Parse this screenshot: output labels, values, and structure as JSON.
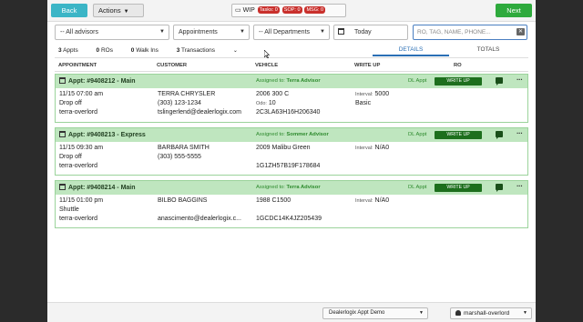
{
  "toolbar": {
    "back_label": "Back",
    "actions_label": "Actions",
    "wip_label": "WIP",
    "tasks_badge": "Tasks: 0",
    "sop_badge": "SOP: 0",
    "msg_badge": "MSG: 0",
    "next_label": "Next"
  },
  "filters": {
    "advisors": "-- All advisors",
    "type": "Appointments",
    "departments": "-- All Departments",
    "date": "Today",
    "search_placeholder": "RO, TAG, NAME, PHONE..."
  },
  "counts": [
    {
      "n": "3",
      "label": "Appts"
    },
    {
      "n": "0",
      "label": "ROs"
    },
    {
      "n": "0",
      "label": "Walk Ins"
    },
    {
      "n": "3",
      "label": "Transactions"
    }
  ],
  "tabs": {
    "details": "DETAILS",
    "totals": "TOTALS"
  },
  "columns": {
    "appointment": "APPOINTMENT",
    "customer": "CUSTOMER",
    "vehicle": "VEHICLE",
    "writeup": "WRITE UP",
    "ro": "RO"
  },
  "appointments": [
    {
      "title": "Appt: #9408212 - Main",
      "assigned_label": "Assigned to:",
      "advisor": "Terra Advisor",
      "dl": "DL Appt",
      "writeup_btn": "WRITE UP",
      "time": "11/15 07:00 am",
      "transport": "Drop off",
      "created_by": "terra-overlord",
      "customer_name": "TERRA CHRYSLER",
      "phone": "(303) 123-1234",
      "email": "tslingerlend@dealerlogix.com",
      "vehicle": "2006 300 C",
      "odo_label": "Odo:",
      "odo": "10",
      "vin": "2C3LA63H16H206340",
      "interval_label": "Interval:",
      "interval": "5000",
      "package": "Basic"
    },
    {
      "title": "Appt: #9408213 - Express",
      "assigned_label": "Assigned to:",
      "advisor": "Sommer Advisor",
      "dl": "DL Appt",
      "writeup_btn": "WRITE UP",
      "time": "11/15 09:30 am",
      "transport": "Drop off",
      "created_by": "terra-overlord",
      "customer_name": "BARBARA SMITH",
      "phone": "(303) 555-5555",
      "email": "",
      "vehicle": "2009 Malibu Green",
      "odo_label": "",
      "odo": "",
      "vin": "1G1ZH57B19F178684",
      "interval_label": "Interval:",
      "interval": "N/A0",
      "package": ""
    },
    {
      "title": "Appt: #9408214 - Main",
      "assigned_label": "Assigned to:",
      "advisor": "Terra Advisor",
      "dl": "DL Appt",
      "writeup_btn": "WRITE UP",
      "time": "11/15 01:00 pm",
      "transport": "Shuttle",
      "created_by": "terra-overlord",
      "customer_name": "BILBO BAGGINS",
      "phone": "",
      "email": "anascimento@dealerlogix.c...",
      "vehicle": "1988 C1500",
      "odo_label": "",
      "odo": "",
      "vin": "1GCDC14K4JZ205439",
      "interval_label": "Interval:",
      "interval": "N/A0",
      "package": ""
    }
  ],
  "footer": {
    "store": "Dealerlogix Appt Demo",
    "user": "marshall-overlord"
  },
  "colors": {
    "accent": "#3bb5c6",
    "next": "#2eaa3d",
    "appt_header": "#bfe6bf",
    "writeup_btn": "#1d6f1d",
    "badge": "#c9302c"
  }
}
